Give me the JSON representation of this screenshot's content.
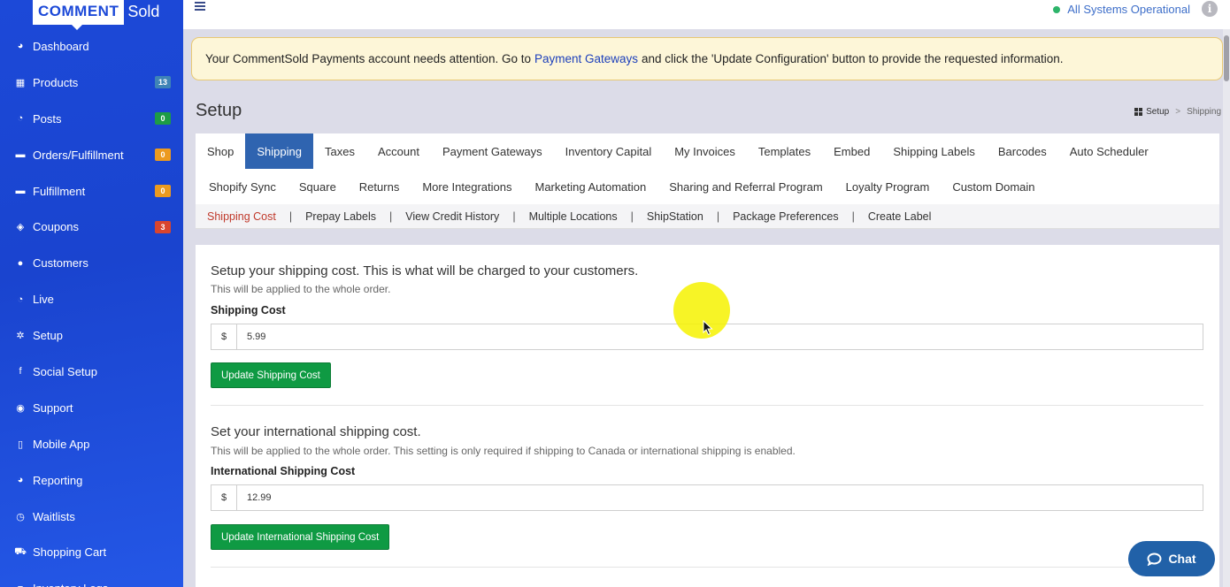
{
  "brand": {
    "word1": "COMMENT",
    "word2": "Sold"
  },
  "sidebar": {
    "items": [
      {
        "label": "Dashboard",
        "icon": "dashboard-icon",
        "glyph": "◕"
      },
      {
        "label": "Products",
        "icon": "grid-icon",
        "glyph": "▦",
        "badge": "13",
        "badge_color": "#3f84b6"
      },
      {
        "label": "Posts",
        "icon": "rss-icon",
        "glyph": "◔",
        "badge": "0",
        "badge_color": "#1d9c45"
      },
      {
        "label": "Orders/Fulfillment",
        "icon": "truck-icon",
        "glyph": "▬",
        "badge": "0",
        "badge_color": "#ec9a1f"
      },
      {
        "label": "Fulfillment",
        "icon": "truck-icon",
        "glyph": "▬",
        "badge": "0",
        "badge_color": "#ec9a1f"
      },
      {
        "label": "Coupons",
        "icon": "tag-icon",
        "glyph": "◈",
        "badge": "3",
        "badge_color": "#d9452f"
      },
      {
        "label": "Customers",
        "icon": "user-icon",
        "glyph": "●"
      },
      {
        "label": "Live",
        "icon": "rss-icon",
        "glyph": "◔"
      },
      {
        "label": "Setup",
        "icon": "cogs-icon",
        "glyph": "✲"
      },
      {
        "label": "Social Setup",
        "icon": "facebook-icon",
        "glyph": "f"
      },
      {
        "label": "Support",
        "icon": "comments-icon",
        "glyph": "◉"
      },
      {
        "label": "Mobile App",
        "icon": "mobile-icon",
        "glyph": "▯"
      },
      {
        "label": "Reporting",
        "icon": "pie-chart-icon",
        "glyph": "◕"
      },
      {
        "label": "Waitlists",
        "icon": "clock-icon",
        "glyph": "◷"
      },
      {
        "label": "Shopping Cart",
        "icon": "cart-icon",
        "glyph": "⛟"
      },
      {
        "label": "Inventory Logs",
        "icon": "list-icon",
        "glyph": "≡"
      }
    ]
  },
  "topbar": {
    "status": "All Systems Operational",
    "status_color": "#2db46a"
  },
  "alert": {
    "before": "Your CommentSold Payments account needs attention. Go to",
    "link": "Payment Gateways",
    "after": "and click the 'Update Configuration' button to provide the requested information."
  },
  "page": {
    "title": "Setup"
  },
  "breadcrumb": {
    "home": "Setup",
    "current": "Shipping"
  },
  "tabs": {
    "row1": [
      "Shop",
      "Shipping",
      "Taxes",
      "Account",
      "Payment Gateways",
      "Inventory Capital",
      "My Invoices",
      "Templates",
      "Embed",
      "Shipping Labels",
      "Barcodes",
      "Auto Scheduler"
    ],
    "row2": [
      "Shopify Sync",
      "Square",
      "Returns",
      "More Integrations",
      "Marketing Automation",
      "Sharing and Referral Program",
      "Loyalty Program",
      "Custom Domain"
    ],
    "active": "Shipping"
  },
  "subtabs": {
    "items": [
      "Shipping Cost",
      "Prepay Labels",
      "View Credit History",
      "Multiple Locations",
      "ShipStation",
      "Package Preferences",
      "Create Label"
    ],
    "active": "Shipping Cost",
    "separator": "|"
  },
  "shipping": {
    "title": "Setup your shipping cost. This is what will be charged to your customers.",
    "desc": "This will be applied to the whole order.",
    "label": "Shipping Cost",
    "currency": "$",
    "value": "5.99",
    "button": "Update Shipping Cost"
  },
  "international": {
    "title": "Set your international shipping cost.",
    "desc": "This will be applied to the whole order. This setting is only required if shipping to Canada or international shipping is enabled.",
    "label": "International Shipping Cost",
    "currency": "$",
    "value": "12.99",
    "button": "Update International Shipping Cost"
  },
  "chat": {
    "label": "Chat"
  },
  "colors": {
    "accent": "#2f64b0",
    "sidebar": "#1c49d8",
    "button": "#0f9a43"
  }
}
